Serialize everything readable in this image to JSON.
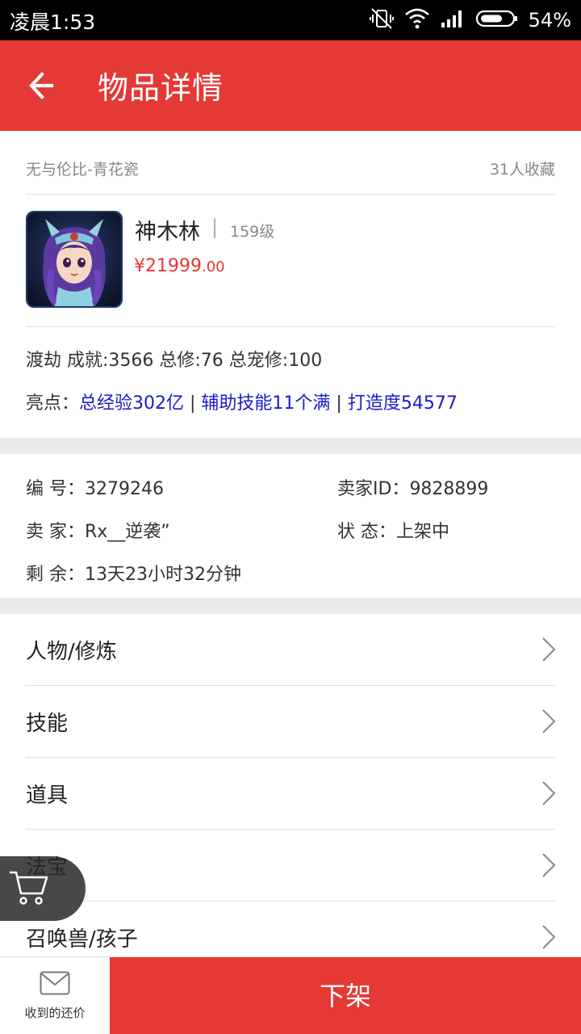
{
  "status_bar": {
    "time": "凌晨1:53",
    "battery": "54%"
  },
  "app_bar": {
    "title": "物品详情"
  },
  "item": {
    "server": "无与伦比-青花瓷",
    "favorites": "31人收藏",
    "name": "神木林",
    "separator": "|",
    "level": "159级",
    "price_main": "¥21999",
    "price_decimal": ".00",
    "achievements": "渡劫  成就:3566  总修:76  总宠修:100",
    "highlights_label": "亮点：",
    "highlights": [
      "总经验302亿",
      "辅助技能11个满",
      "打造度54577"
    ],
    "highlight_sep": " | "
  },
  "info": {
    "number_label": "编  号：",
    "number": "3279246",
    "seller_id_label": "卖家ID：",
    "seller_id": "9828899",
    "seller_label": "卖  家：",
    "seller": "Rx__逆袭”",
    "status_label": "状  态：",
    "status": "上架中",
    "remaining_label": "剩  余：",
    "remaining": "13天23小时32分钟"
  },
  "menu": [
    "人物/修炼",
    "技能",
    "道具",
    "法宝",
    "召唤兽/孩子"
  ],
  "bottom_bar": {
    "offers_label": "收到的还价",
    "delist_label": "下架"
  },
  "colors": {
    "accent": "#e53935",
    "link": "#1a1acc",
    "divider": "#e0e0e0",
    "gap": "#ebebeb"
  }
}
